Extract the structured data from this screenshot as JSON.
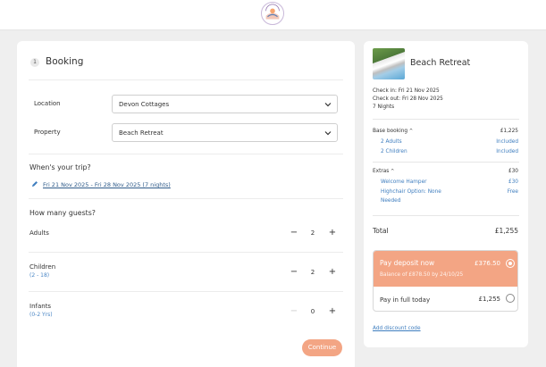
{
  "header": {
    "logo_alt": "brand-logo"
  },
  "booking": {
    "step_number": "1",
    "title": "Booking",
    "location_label": "Location",
    "location_value": "Devon Cottages",
    "property_label": "Property",
    "property_value": "Beach Retreat",
    "trip_question": "When's your trip?",
    "trip_dates": "Fri 21 Nov 2025 - Fri 28 Nov 2025 (7 nights)",
    "guests_question": "How many guests?",
    "guests": [
      {
        "label": "Adults",
        "sub": "",
        "value": "2",
        "minus": "−",
        "plus": "+"
      },
      {
        "label": "Children",
        "sub": "(2 - 18)",
        "value": "2",
        "minus": "−",
        "plus": "+"
      },
      {
        "label": "Infants",
        "sub": "(0-2 Yrs)",
        "value": "0",
        "minus": "−",
        "plus": "+"
      }
    ],
    "continue_label": "Continue"
  },
  "summary": {
    "property_name": "Beach Retreat",
    "check_in": "Check in: Fri 21 Nov 2025",
    "check_out": "Check out: Fri 28 Nov 2025",
    "nights": "7 Nights",
    "base_label": "Base booking",
    "base_amount": "£1,225",
    "base_items": [
      {
        "label": "2 Adults",
        "value": "Included"
      },
      {
        "label": "2 Children",
        "value": "Included"
      }
    ],
    "extras_label": "Extras",
    "extras_amount": "£30",
    "extras_items": [
      {
        "label": "Welcome Hamper",
        "value": "£30"
      },
      {
        "label": "Highchair Option: None",
        "value": "Free"
      },
      {
        "label": "Needed",
        "value": ""
      }
    ],
    "caret": "^",
    "total_label": "Total",
    "total_amount": "£1,255",
    "deposit_label": "Pay deposit now",
    "deposit_amount": "£376.50",
    "deposit_balance": "Balance of £878.50 by 24/10/25",
    "full_label": "Pay in full today",
    "full_amount": "£1,255",
    "discount_link": "Add discount code"
  },
  "colors": {
    "accent": "#f3a584",
    "link": "#3f7ebf",
    "background": "#efefef"
  },
  "icons": [
    "brand-logo-icon",
    "chevron-down-icon",
    "pencil-icon",
    "radio-selected-icon",
    "radio-unselected-icon"
  ]
}
